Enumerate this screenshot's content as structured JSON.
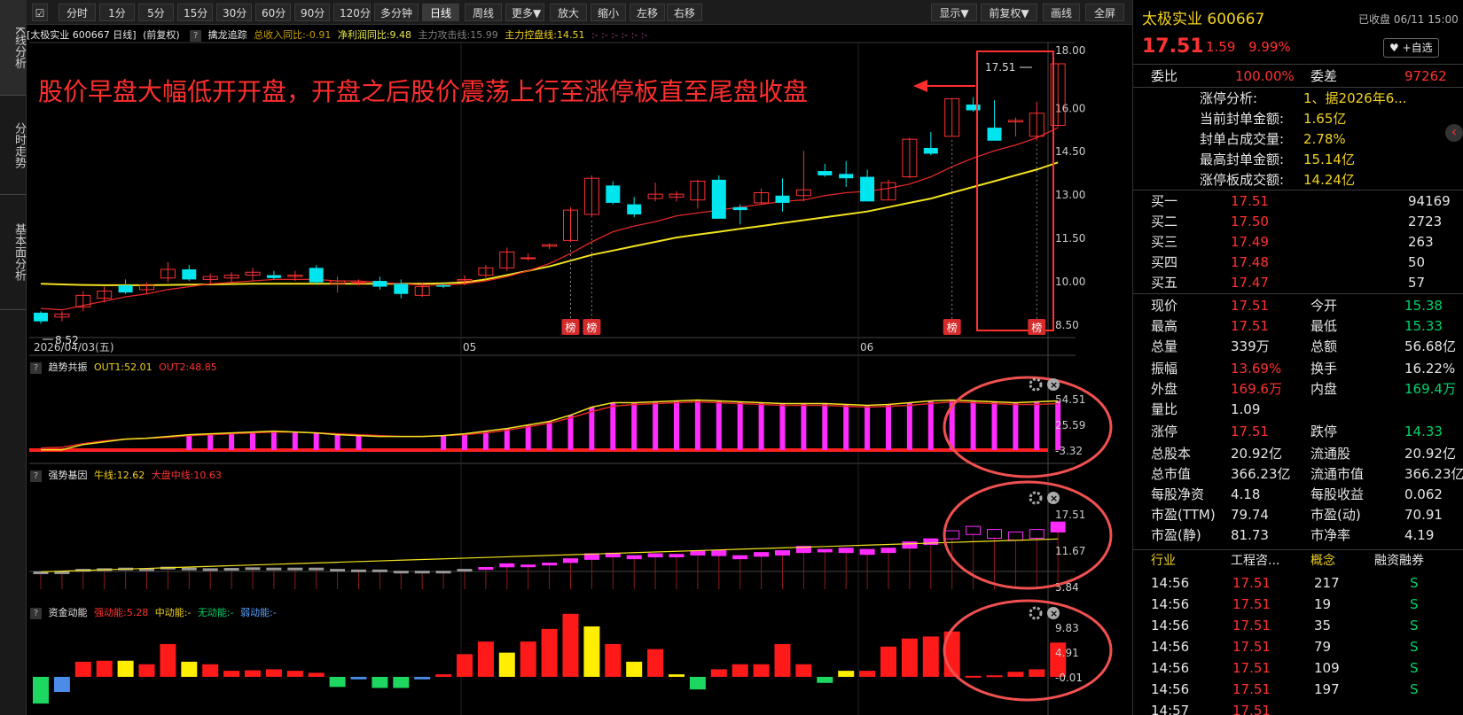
{
  "left_nav": [
    "K线分析",
    "分时走势",
    "基本面分析"
  ],
  "toolbar": {
    "left": [
      "分时",
      "1分",
      "5分",
      "15分",
      "30分",
      "60分",
      "90分",
      "120分",
      "多分钟",
      "日线",
      "周线",
      "更多▼",
      "放大",
      "缩小",
      "左移",
      "右移"
    ],
    "right": [
      "显示▼",
      "前复权▼",
      "画线",
      "全屏"
    ]
  },
  "info": {
    "name": "[太极实业 600667 日线]",
    "fq": "(前复权)",
    "ind": "擒龙追踪",
    "v1": "总收入同比:-0.91",
    "v2": "净利润同比:9.48",
    "v3": "主力攻击线:15.99",
    "v4": "主力控盘线:14.51",
    "v5": ":-  :-  :-  :-  :-  :-"
  },
  "annotation": "股价早盘大幅低开开盘，开盘之后股价震荡上行至涨停板直至尾盘收盘",
  "price_axis": [
    "18.00",
    "16.00",
    "14.50",
    "13.00",
    "11.50",
    "10.00",
    "8.50"
  ],
  "hi_label": "17.51",
  "lo_label": "8.52",
  "date_label": "2026/04/03(五)",
  "month_labels": [
    "05",
    "06"
  ],
  "bang": "榜",
  "ind1": {
    "title": "趋势共振",
    "out1": "OUT1:52.01",
    "out2": "OUT2:48.85",
    "axis": [
      "54.51",
      "25.59",
      "-3.32"
    ]
  },
  "ind2": {
    "title": "强势基因",
    "a": "牛线:12.62",
    "b": "大盘中线:10.63",
    "axis": [
      "17.51",
      "11.67",
      "5.84"
    ]
  },
  "ind3": {
    "title": "资金动能",
    "a": "强动能:5.28",
    "b": "中动能:-",
    "c": "无动能:-",
    "d": "弱动能:-",
    "axis": [
      "9.83",
      "4.91",
      "-0.01"
    ]
  },
  "chart_data": {
    "type": "candlestick",
    "ohlc": [
      [
        8.9,
        8.95,
        8.52,
        8.6
      ],
      [
        8.75,
        8.95,
        8.6,
        8.85
      ],
      [
        9.1,
        9.65,
        8.95,
        9.5
      ],
      [
        9.4,
        9.8,
        9.25,
        9.65
      ],
      [
        9.85,
        10.05,
        9.55,
        9.6
      ],
      [
        9.7,
        9.95,
        9.55,
        9.85
      ],
      [
        10.1,
        10.65,
        9.95,
        10.4
      ],
      [
        10.4,
        10.55,
        10.0,
        10.05
      ],
      [
        10.05,
        10.25,
        9.9,
        10.15
      ],
      [
        10.1,
        10.3,
        9.9,
        10.2
      ],
      [
        10.2,
        10.45,
        10.0,
        10.3
      ],
      [
        10.2,
        10.35,
        10.05,
        10.1
      ],
      [
        10.15,
        10.35,
        10.0,
        10.2
      ],
      [
        10.45,
        10.55,
        9.9,
        9.95
      ],
      [
        9.9,
        10.15,
        9.6,
        10.0
      ],
      [
        9.95,
        10.05,
        9.85,
        9.95
      ],
      [
        10.0,
        10.15,
        9.7,
        9.8
      ],
      [
        9.9,
        10.05,
        9.4,
        9.55
      ],
      [
        9.5,
        9.95,
        9.45,
        9.8
      ],
      [
        9.85,
        9.95,
        9.75,
        9.8
      ],
      [
        10.0,
        10.2,
        9.85,
        10.05
      ],
      [
        10.2,
        10.55,
        10.05,
        10.45
      ],
      [
        10.45,
        11.15,
        10.35,
        11.0
      ],
      [
        10.8,
        10.95,
        10.7,
        10.8
      ],
      [
        11.2,
        11.3,
        11.1,
        11.25
      ],
      [
        11.4,
        12.55,
        11.35,
        12.45
      ],
      [
        12.3,
        13.65,
        12.2,
        13.55
      ],
      [
        13.3,
        13.45,
        12.65,
        12.7
      ],
      [
        12.65,
        12.9,
        12.2,
        12.3
      ],
      [
        12.85,
        13.4,
        12.75,
        13.0
      ],
      [
        12.9,
        13.1,
        12.75,
        13.0
      ],
      [
        12.8,
        13.5,
        12.5,
        13.45
      ],
      [
        13.5,
        13.65,
        12.15,
        12.15
      ],
      [
        12.55,
        12.65,
        11.95,
        12.45
      ],
      [
        12.7,
        13.2,
        12.65,
        13.05
      ],
      [
        12.95,
        13.55,
        12.4,
        12.7
      ],
      [
        12.95,
        14.5,
        12.75,
        13.15
      ],
      [
        13.8,
        14.05,
        13.6,
        13.65
      ],
      [
        13.7,
        14.15,
        13.25,
        13.55
      ],
      [
        13.6,
        13.85,
        12.75,
        12.75
      ],
      [
        12.8,
        13.5,
        12.8,
        13.4
      ],
      [
        13.6,
        14.95,
        13.55,
        14.9
      ],
      [
        14.6,
        15.15,
        14.35,
        14.4
      ],
      [
        15.0,
        16.3,
        15.0,
        16.3
      ],
      [
        16.1,
        16.35,
        15.85,
        15.9
      ],
      [
        15.3,
        16.25,
        14.85,
        14.85
      ],
      [
        15.5,
        15.65,
        15.0,
        15.55
      ],
      [
        15.0,
        16.2,
        14.85,
        15.8
      ],
      [
        15.38,
        17.51,
        15.33,
        17.51
      ]
    ],
    "ma_red": [
      9.05,
      9.0,
      9.15,
      9.3,
      9.45,
      9.55,
      9.7,
      9.8,
      9.9,
      9.95,
      10.0,
      10.05,
      10.05,
      10.05,
      10.0,
      10.0,
      9.95,
      9.9,
      9.85,
      9.85,
      9.9,
      10.0,
      10.15,
      10.35,
      10.6,
      10.95,
      11.35,
      11.7,
      11.9,
      12.05,
      12.25,
      12.35,
      12.45,
      12.55,
      12.65,
      12.75,
      12.8,
      12.95,
      13.05,
      13.1,
      13.2,
      13.35,
      13.6,
      13.95,
      14.25,
      14.5,
      14.7,
      14.95,
      15.3
    ],
    "ma_yellow": [
      9.9,
      9.88,
      9.86,
      9.85,
      9.85,
      9.85,
      9.86,
      9.87,
      9.88,
      9.89,
      9.9,
      9.9,
      9.9,
      9.9,
      9.9,
      9.9,
      9.9,
      9.9,
      9.9,
      9.92,
      9.95,
      10.05,
      10.2,
      10.35,
      10.5,
      10.7,
      10.9,
      11.05,
      11.2,
      11.35,
      11.5,
      11.6,
      11.7,
      11.8,
      11.9,
      12.0,
      12.1,
      12.2,
      12.3,
      12.4,
      12.55,
      12.7,
      12.85,
      13.05,
      13.25,
      13.45,
      13.65,
      13.85,
      14.1
    ],
    "ind1_hist": [
      -3,
      -3,
      3,
      6,
      9,
      10,
      12,
      14,
      15,
      16,
      17,
      18,
      17,
      16,
      14,
      13,
      12,
      12,
      12,
      13,
      15,
      18,
      21,
      25,
      29,
      36,
      45,
      50,
      50,
      51,
      52,
      53,
      52,
      51,
      50,
      49,
      49,
      49,
      48,
      47,
      48,
      50,
      52,
      53,
      52,
      51,
      50,
      51,
      52
    ],
    "ind1_out2": [
      -1,
      0,
      4,
      7,
      9,
      10,
      11,
      13,
      14,
      15,
      16,
      17,
      17,
      16,
      15,
      14,
      13,
      12,
      12,
      13,
      14,
      16,
      19,
      23,
      27,
      33,
      40,
      46,
      48,
      49,
      50,
      51,
      50,
      49,
      48,
      47,
      47,
      47,
      46,
      45,
      46,
      47,
      49,
      51,
      50,
      49,
      48,
      48,
      49
    ],
    "ind2_bars": [
      [
        7.9,
        8.2
      ],
      [
        8.05,
        8.2
      ],
      [
        8.4,
        8.6
      ],
      [
        8.5,
        8.7
      ],
      [
        8.7,
        8.8
      ],
      [
        8.55,
        8.7
      ],
      [
        8.8,
        8.95
      ],
      [
        8.6,
        8.8
      ],
      [
        8.6,
        8.7
      ],
      [
        8.6,
        8.75
      ],
      [
        8.7,
        8.85
      ],
      [
        8.65,
        8.8
      ],
      [
        8.7,
        8.8
      ],
      [
        8.6,
        8.8
      ],
      [
        8.4,
        8.6
      ],
      [
        8.4,
        8.5
      ],
      [
        8.3,
        8.5
      ],
      [
        8.1,
        8.3
      ],
      [
        8.1,
        8.3
      ],
      [
        8.1,
        8.3
      ],
      [
        8.4,
        8.6
      ],
      [
        8.6,
        8.9
      ],
      [
        9.0,
        9.5
      ],
      [
        9.1,
        9.3
      ],
      [
        9.3,
        9.6
      ],
      [
        9.7,
        10.3
      ],
      [
        10.2,
        11.1
      ],
      [
        10.6,
        11.2
      ],
      [
        10.3,
        10.8
      ],
      [
        10.6,
        11.1
      ],
      [
        10.6,
        11.0
      ],
      [
        10.9,
        11.6
      ],
      [
        10.8,
        11.6
      ],
      [
        10.3,
        10.8
      ],
      [
        10.7,
        11.3
      ],
      [
        10.9,
        11.6
      ],
      [
        11.3,
        12.3
      ],
      [
        11.4,
        11.8
      ],
      [
        11.3,
        12.0
      ],
      [
        11.0,
        11.8
      ],
      [
        11.3,
        12.0
      ],
      [
        12.0,
        13.0
      ],
      [
        12.6,
        13.5
      ],
      [
        13.5,
        14.8
      ],
      [
        14.2,
        15.5
      ],
      [
        13.6,
        15.0
      ],
      [
        13.3,
        14.6
      ],
      [
        13.6,
        15.0
      ],
      [
        14.6,
        16.2
      ]
    ],
    "ind3_vals": [
      -5.3,
      -3,
      3,
      3.2,
      3.2,
      2.5,
      6.5,
      3,
      2.5,
      1.2,
      1.3,
      1.5,
      1.2,
      0.8,
      -2,
      -0.5,
      -2.2,
      -2.2,
      -0.5,
      0.5,
      4.5,
      7,
      4.8,
      7,
      9.5,
      12.5,
      10,
      6.5,
      3,
      5.5,
      0.5,
      -2.5,
      1.5,
      2.5,
      2.5,
      6.5,
      2.5,
      -1.2,
      1.2,
      1.2,
      6,
      7.6,
      8,
      9,
      0.2,
      0.3,
      1,
      1.5,
      6.8
    ],
    "ind3_colors": [
      "g",
      "b",
      "r",
      "r",
      "y",
      "r",
      "r",
      "y",
      "r",
      "r",
      "r",
      "r",
      "r",
      "r",
      "g",
      "b",
      "g",
      "g",
      "b",
      "r",
      "r",
      "r",
      "y",
      "r",
      "r",
      "r",
      "y",
      "r",
      "y",
      "r",
      "y",
      "g",
      "r",
      "r",
      "r",
      "r",
      "r",
      "g",
      "y",
      "r",
      "r",
      "r",
      "r",
      "r",
      "r",
      "r",
      "r",
      "r",
      "r"
    ]
  },
  "right_panel": {
    "title": "太极实业 600667",
    "status": "已收盘 06/11 15:00",
    "price": "17.51",
    "chg": "1.59",
    "pct": "9.99%",
    "fav": "♥ +自选",
    "wb": "委比",
    "wb_v": "100.00%",
    "wc": "委差",
    "wc_v": "97262",
    "zt": [
      [
        "涨停分析:",
        "1、据2026年6..."
      ],
      [
        "当前封单金额:",
        "1.65亿"
      ],
      [
        "封单占成交量:",
        "2.78%"
      ],
      [
        "最高封单金额:",
        "15.14亿"
      ],
      [
        "涨停板成交额:",
        "14.24亿"
      ]
    ],
    "bids": [
      [
        "买一",
        "17.51",
        "94169"
      ],
      [
        "买二",
        "17.50",
        "2723"
      ],
      [
        "买三",
        "17.49",
        "263"
      ],
      [
        "买四",
        "17.48",
        "50"
      ],
      [
        "买五",
        "17.47",
        "57"
      ]
    ],
    "stats": [
      [
        "现价",
        "17.51",
        "r",
        "今开",
        "15.38",
        "g"
      ],
      [
        "最高",
        "17.51",
        "r",
        "最低",
        "15.33",
        "g"
      ],
      [
        "总量",
        "339万",
        "w",
        "总额",
        "56.68亿",
        "w"
      ],
      [
        "振幅",
        "13.69%",
        "r",
        "换手",
        "16.22%",
        "w"
      ],
      [
        "外盘",
        "169.6万",
        "r",
        "内盘",
        "169.4万",
        "g"
      ],
      [
        "量比",
        "1.09",
        "w",
        "",
        "",
        " "
      ],
      [
        "涨停",
        "17.51",
        "r",
        "跌停",
        "14.33",
        "g"
      ],
      [
        "总股本",
        "20.92亿",
        "w",
        "流通股",
        "20.92亿",
        "w"
      ],
      [
        "总市值",
        "366.23亿",
        "w",
        "流通市值",
        "366.23亿",
        "w"
      ],
      [
        "每股净资",
        "4.18",
        "w",
        "每股收益",
        "0.062",
        "w"
      ],
      [
        "市盈(TTM)",
        "79.74",
        "w",
        "市盈(动)",
        "70.91",
        "w"
      ],
      [
        "市盈(静)",
        "81.73",
        "w",
        "市净率",
        "4.19",
        "w"
      ]
    ],
    "tabs": [
      "行业",
      "工程咨...",
      "概念",
      "融资融券"
    ],
    "ticks": [
      [
        "14:56",
        "17.51",
        "217",
        "S"
      ],
      [
        "14:56",
        "17.51",
        "19",
        "S"
      ],
      [
        "14:56",
        "17.51",
        "35",
        "S"
      ],
      [
        "14:56",
        "17.51",
        "79",
        "S"
      ],
      [
        "14:56",
        "17.51",
        "109",
        "S"
      ],
      [
        "14:56",
        "17.51",
        "197",
        "S"
      ],
      [
        "14:57",
        "17.51",
        "",
        ""
      ]
    ]
  }
}
